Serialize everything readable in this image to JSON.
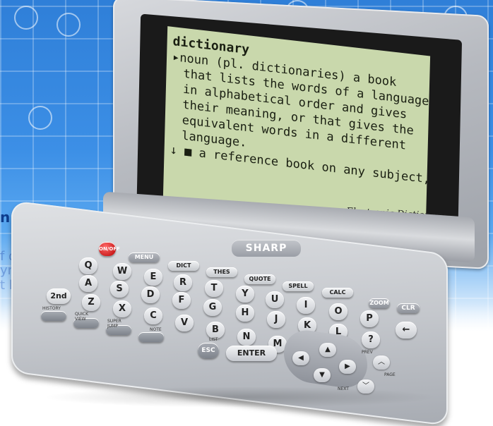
{
  "screen": {
    "headword": "dictionary",
    "lines": [
      "▸noun (pl. dictionaries) a book",
      "that lists the words of a language",
      "in alphabetical order and gives",
      "their meaning, or that gives the",
      "equivalent words in a different",
      "language.",
      "↓ ■ a reference book on any subject,"
    ]
  },
  "lid_label": "Electronic Dictionary",
  "brand": "SHARP",
  "background_text": {
    "line1": "n",
    "line2": "f one's",
    "line3": "yner",
    "line4": "t k"
  },
  "keys": {
    "power": "ON/OFF",
    "menu": "MENU",
    "dict": "DICT",
    "thes": "THES",
    "quote": "QUOTE",
    "spell": "SPELL",
    "calc": "CALC",
    "zoom": "ZOOM",
    "clr": "CLR",
    "second": "2nd",
    "history": "HISTORY",
    "quick_view": "QUICK VIEW",
    "super_jump": "SUPER JUMP",
    "note": "NOTE",
    "esc": "ESC",
    "enter": "ENTER",
    "question": "?",
    "back": "←",
    "prev": "PREV",
    "page": "PAGE",
    "next": "NEXT",
    "list": "LIST",
    "row1": [
      "Q",
      "W",
      "E",
      "R",
      "T",
      "Y",
      "U",
      "I",
      "O",
      "P"
    ],
    "row2": [
      "A",
      "S",
      "D",
      "F",
      "G",
      "H",
      "J",
      "K",
      "L"
    ],
    "row3": [
      "Z",
      "X",
      "C",
      "V",
      "B",
      "N",
      "M"
    ]
  }
}
